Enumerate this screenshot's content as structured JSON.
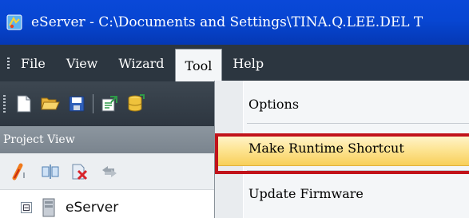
{
  "window": {
    "title": "eServer - C:\\Documents and Settings\\TINA.Q.LEE.DEL T",
    "app_icon": "eserver-app-icon"
  },
  "menubar": {
    "items": [
      {
        "label": "File",
        "open": false
      },
      {
        "label": "View",
        "open": false
      },
      {
        "label": "Wizard",
        "open": false
      },
      {
        "label": "Tool",
        "open": true
      },
      {
        "label": "Help",
        "open": false
      }
    ]
  },
  "toolbar": {
    "buttons": [
      "new-file-icon",
      "open-folder-icon",
      "save-icon",
      "export-icon",
      "database-icon"
    ]
  },
  "project_view": {
    "title": "Project View",
    "tools": [
      "link-icon",
      "split-icon",
      "delete-icon",
      "refresh-icon"
    ],
    "tree": {
      "root_label": "eServer",
      "expander": "⊟"
    }
  },
  "tool_menu": {
    "items": [
      {
        "label": "Options"
      },
      {
        "label": "Make Runtime Shortcut",
        "highlighted": true
      },
      {
        "label": "Update Firmware"
      }
    ]
  },
  "colors": {
    "titlebar": "#0746d2",
    "menubar": "#2c3640",
    "highlight": "#fde493",
    "callout": "#c1121a"
  }
}
